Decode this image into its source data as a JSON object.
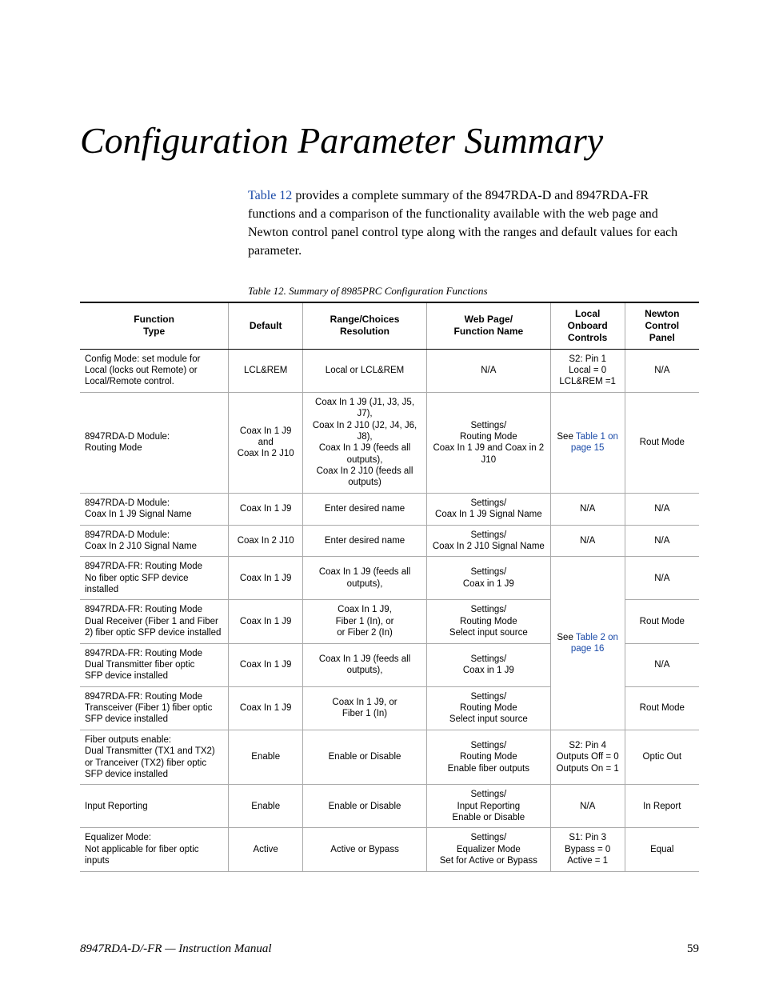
{
  "title": "Configuration Parameter Summary",
  "intro_link": "Table 12",
  "intro_rest": " provides a complete summary of the 8947RDA-D and 8947RDA-FR functions and a comparison of the functionality available with the web page and Newton control panel control type along with the ranges and default values for each parameter.",
  "caption": "Table 12.  Summary of 8985PRC Configuration Functions",
  "headers": [
    "Function\nType",
    "Default",
    "Range/Choices\nResolution",
    "Web Page/\nFunction Name",
    "Local\nOnboard\nControls",
    "Newton\nControl\nPanel"
  ],
  "rows": [
    {
      "fn": "Config Mode: set module for Local (locks out Remote) or Local/Remote control.",
      "def": "LCL&REM",
      "range": "Local or LCL&REM",
      "web": "N/A",
      "local": "S2: Pin 1\nLocal = 0\nLCL&REM =1",
      "newton": "N/A"
    },
    {
      "fn": "8947RDA-D Module:\nRouting Mode",
      "def": "Coax In 1 J9\nand\nCoax In 2 J10",
      "range": "Coax In 1 J9 (J1, J3, J5, J7),\nCoax In 2 J10 (J2, J4, J6, J8),\nCoax In 1 J9 (feeds all outputs),\nCoax In 2 J10 (feeds all outputs)",
      "web": "Settings/\nRouting Mode\nCoax In 1 J9 and Coax in 2 J10",
      "local_link": {
        "pre": "See ",
        "link": "Table 1 on page 15"
      },
      "newton": "Rout Mode"
    },
    {
      "fn": "8947RDA-D Module:\nCoax In 1 J9 Signal Name",
      "def": "Coax In 1 J9",
      "range": "Enter desired name",
      "web": "Settings/\nCoax In 1 J9 Signal Name",
      "local": "N/A",
      "newton": "N/A"
    },
    {
      "fn": "8947RDA-D Module:\nCoax In 2 J10 Signal Name",
      "def": "Coax In 2 J10",
      "range": "Enter desired name",
      "web": "Settings/\nCoax In 2 J10 Signal Name",
      "local": "N/A",
      "newton": "N/A"
    },
    {
      "fn": "8947RDA-FR: Routing Mode\nNo fiber optic SFP device installed",
      "def": "Coax In 1 J9",
      "range": "Coax In 1 J9 (feeds all outputs),",
      "web": "Settings/\nCoax in 1 J9",
      "local_span": {
        "pre": "See ",
        "link": "Table 2 on page 16",
        "rowspan": 4
      },
      "newton": "N/A"
    },
    {
      "fn": "8947RDA-FR: Routing Mode\nDual Receiver (Fiber 1 and Fiber 2) fiber optic SFP device installed",
      "def": "Coax In 1 J9",
      "range": "Coax In 1 J9,\nFiber 1 (In), or\nor Fiber 2 (In)",
      "web": "Settings/\nRouting Mode\nSelect input source",
      "newton": "Rout Mode"
    },
    {
      "fn": "8947RDA-FR: Routing Mode\nDual Transmitter fiber optic\nSFP device installed",
      "def": "Coax In 1 J9",
      "range": "Coax In 1 J9 (feeds all outputs),",
      "web": "Settings/\nCoax in 1 J9",
      "newton": "N/A"
    },
    {
      "fn": "8947RDA-FR: Routing Mode\nTransceiver (Fiber 1) fiber optic SFP device installed",
      "def": "Coax In 1 J9",
      "range": "Coax In 1 J9, or\nFiber 1 (In)",
      "web": "Settings/\nRouting Mode\nSelect input source",
      "newton": "Rout Mode"
    },
    {
      "fn": "Fiber outputs enable:\nDual Transmitter (TX1 and TX2) or Tranceiver (TX2) fiber optic\nSFP device installed",
      "def": "Enable",
      "range": "Enable or Disable",
      "web": "Settings/\nRouting Mode\nEnable fiber outputs",
      "local": "S2: Pin 4\nOutputs Off = 0\nOutputs On = 1",
      "newton": "Optic Out"
    },
    {
      "fn": "Input Reporting",
      "def": "Enable",
      "range": "Enable or Disable",
      "web": "Settings/\nInput Reporting\nEnable or Disable",
      "local": "N/A",
      "newton": "In Report"
    },
    {
      "fn": "Equalizer Mode:\nNot applicable for fiber optic inputs",
      "def": "Active",
      "range": "Active or Bypass",
      "web": "Settings/\nEqualizer Mode\nSet for Active or Bypass",
      "local": "S1: Pin 3\nBypass = 0\nActive = 1",
      "newton": "Equal"
    }
  ],
  "footer_left": "8947RDA-D/-FR  —  Instruction Manual",
  "footer_right": "59"
}
